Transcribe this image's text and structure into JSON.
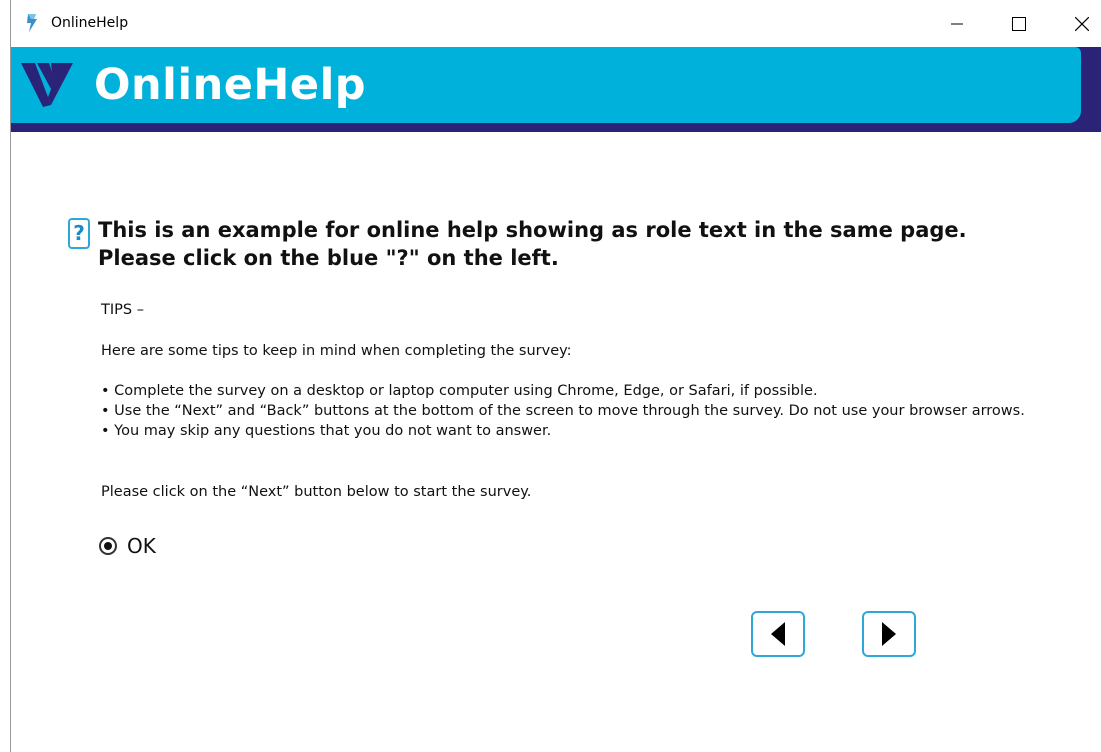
{
  "window": {
    "title": "OnlineHelp",
    "icon": "app-icon"
  },
  "banner": {
    "title": "OnlineHelp",
    "logo": "v-logo",
    "colors": {
      "cyan": "#00b2db",
      "navy": "#2a2378"
    }
  },
  "question": {
    "help_marker": "?",
    "text_line1": "This is an example for online help showing as role text in the same page.",
    "text_line2": "Please click on the blue \"?\" on the left."
  },
  "content": {
    "tips_label": "TIPS –",
    "intro": "Here are some tips to keep in mind when completing the survey:",
    "tips": [
      "• Complete the survey on a desktop or laptop computer using Chrome, Edge, or Safari, if possible.",
      "• Use the “Next” and “Back” buttons at the bottom of the screen to move through the survey. Do not use your browser arrows.",
      "• You may skip any questions that you do not want to answer."
    ],
    "closing": "Please click on the “Next” button below to start the survey."
  },
  "answer": {
    "option_label": "OK",
    "selected": true
  },
  "navigation": {
    "back_icon": "triangle-left-icon",
    "next_icon": "triangle-right-icon",
    "accent": "#2da8d8"
  }
}
